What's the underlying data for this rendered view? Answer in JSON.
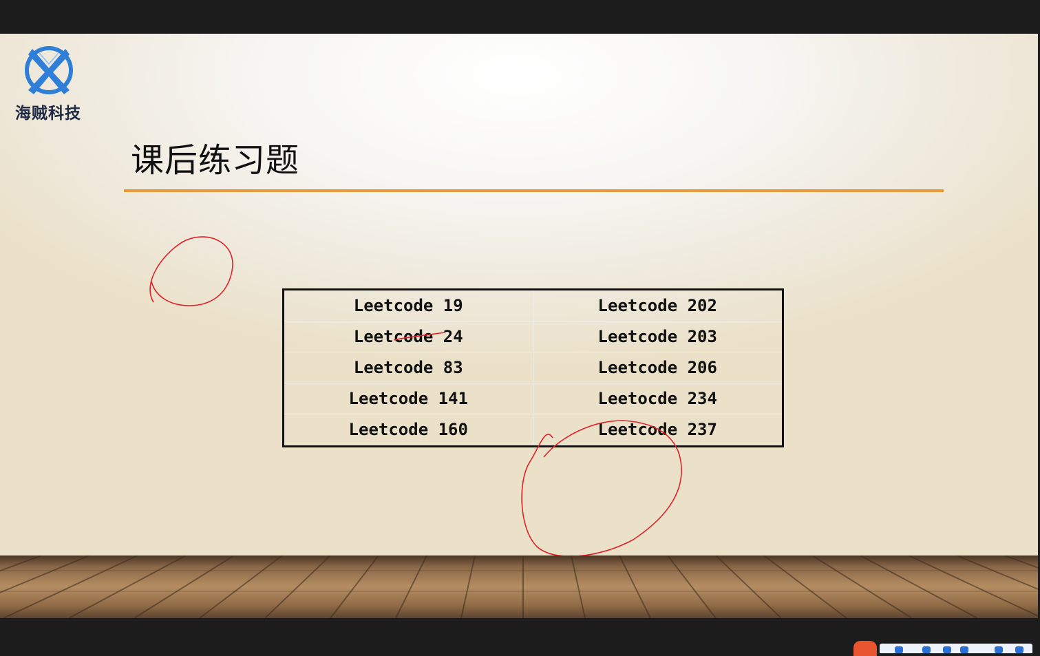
{
  "colors": {
    "accent_rule": "#e89a3a",
    "annotation_pen": "#e0202a",
    "logo_blue": "#2f7fd8",
    "table_border": "#111111"
  },
  "logo": {
    "icon": "x-emblem-icon",
    "text": "海贼科技"
  },
  "slide": {
    "title": "课后练习题"
  },
  "problems": [
    {
      "label": "Leetcode 19"
    },
    {
      "label": "Leetcode 202"
    },
    {
      "label": "Leetcode 24"
    },
    {
      "label": "Leetcode 203"
    },
    {
      "label": "Leetcode 83"
    },
    {
      "label": "Leetcode 206"
    },
    {
      "label": "Leetcode 141"
    },
    {
      "label": "Leetocde 234"
    },
    {
      "label": "Leetcode 160"
    },
    {
      "label": "Leetcode 237"
    }
  ],
  "taskbar": {
    "icons": [
      "sogou-ime-icon",
      "tray-icons"
    ]
  }
}
